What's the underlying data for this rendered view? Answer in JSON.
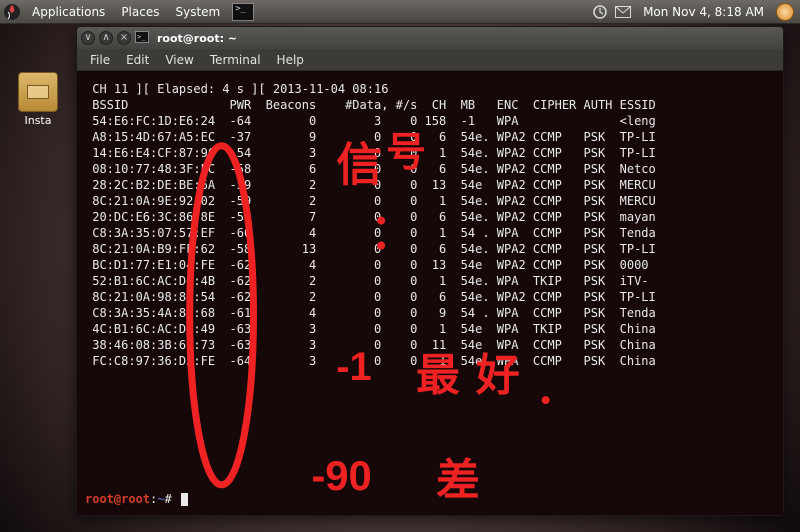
{
  "panel": {
    "menus": [
      "Applications",
      "Places",
      "System"
    ],
    "clock": "Mon Nov  4,  8:18 AM"
  },
  "desktop": {
    "icon1_label": "Insta"
  },
  "window": {
    "title": "root@root: ~",
    "menus": [
      "File",
      "Edit",
      "View",
      "Terminal",
      "Help"
    ]
  },
  "terminal": {
    "status": " CH 11 ][ Elapsed: 4 s ][ 2013-11-04 08:16",
    "header": " BSSID              PWR  Beacons    #Data, #/s  CH  MB   ENC  CIPHER AUTH ESSID",
    "rows": [
      " 54:E6:FC:1D:E6:24  -64        0        3    0 158  -1   WPA              <leng",
      " A8:15:4D:67:A5:EC  -37        9        0    0   6  54e. WPA2 CCMP   PSK  TP-LI",
      " 14:E6:E4:CF:87:96  -54        3        0    0   1  54e. WPA2 CCMP   PSK  TP-LI",
      " 08:10:77:48:3F:EC  -58        6        0    0   6  54e. WPA2 CCMP   PSK  Netco",
      " 28:2C:B2:DE:BE:6A  -59        2        0    0  13  54e  WPA2 CCMP   PSK  MERCU",
      " 8C:21:0A:9E:92:02  -59        2        0    0   1  54e. WPA2 CCMP   PSK  MERCU",
      " 20:DC:E6:3C:86:8E  -59        7        0    0   6  54e. WPA2 CCMP   PSK  mayan",
      " C8:3A:35:07:57:EF  -60        4        0    0   1  54 . WPA  CCMP   PSK  Tenda",
      " 8C:21:0A:B9:FF:62  -58       13        0    0   6  54e. WPA2 CCMP   PSK  TP-LI",
      " BC:D1:77:E1:04:FE  -62        4        0    0  13  54e  WPA2 CCMP   PSK  0000",
      " 52:B1:6C:AC:D6:4B  -62        2        0    0   1  54e. WPA  TKIP   PSK  iTV-",
      " 8C:21:0A:98:8B:54  -62        2        0    0   6  54e. WPA2 CCMP   PSK  TP-LI",
      " C8:3A:35:4A:8A:68  -61        4        0    0   9  54 . WPA  CCMP   PSK  Tenda",
      " 4C:B1:6C:AC:D6:49  -63        3        0    0   1  54e  WPA  TKIP   PSK  China",
      " 38:46:08:3B:67:73  -63        3        0    0  11  54e  WPA  CCMP   PSK  China",
      " FC:C8:97:36:D5:FE  -64        3        0    0   1  54e  WPA  CCMP   PSK  China"
    ],
    "prompt_user": "root@root",
    "prompt_path": "~",
    "prompt_symbol": "#"
  },
  "annotations": {
    "han1": "信号",
    "han2": "-1 最好",
    "han3": "-90 差"
  }
}
